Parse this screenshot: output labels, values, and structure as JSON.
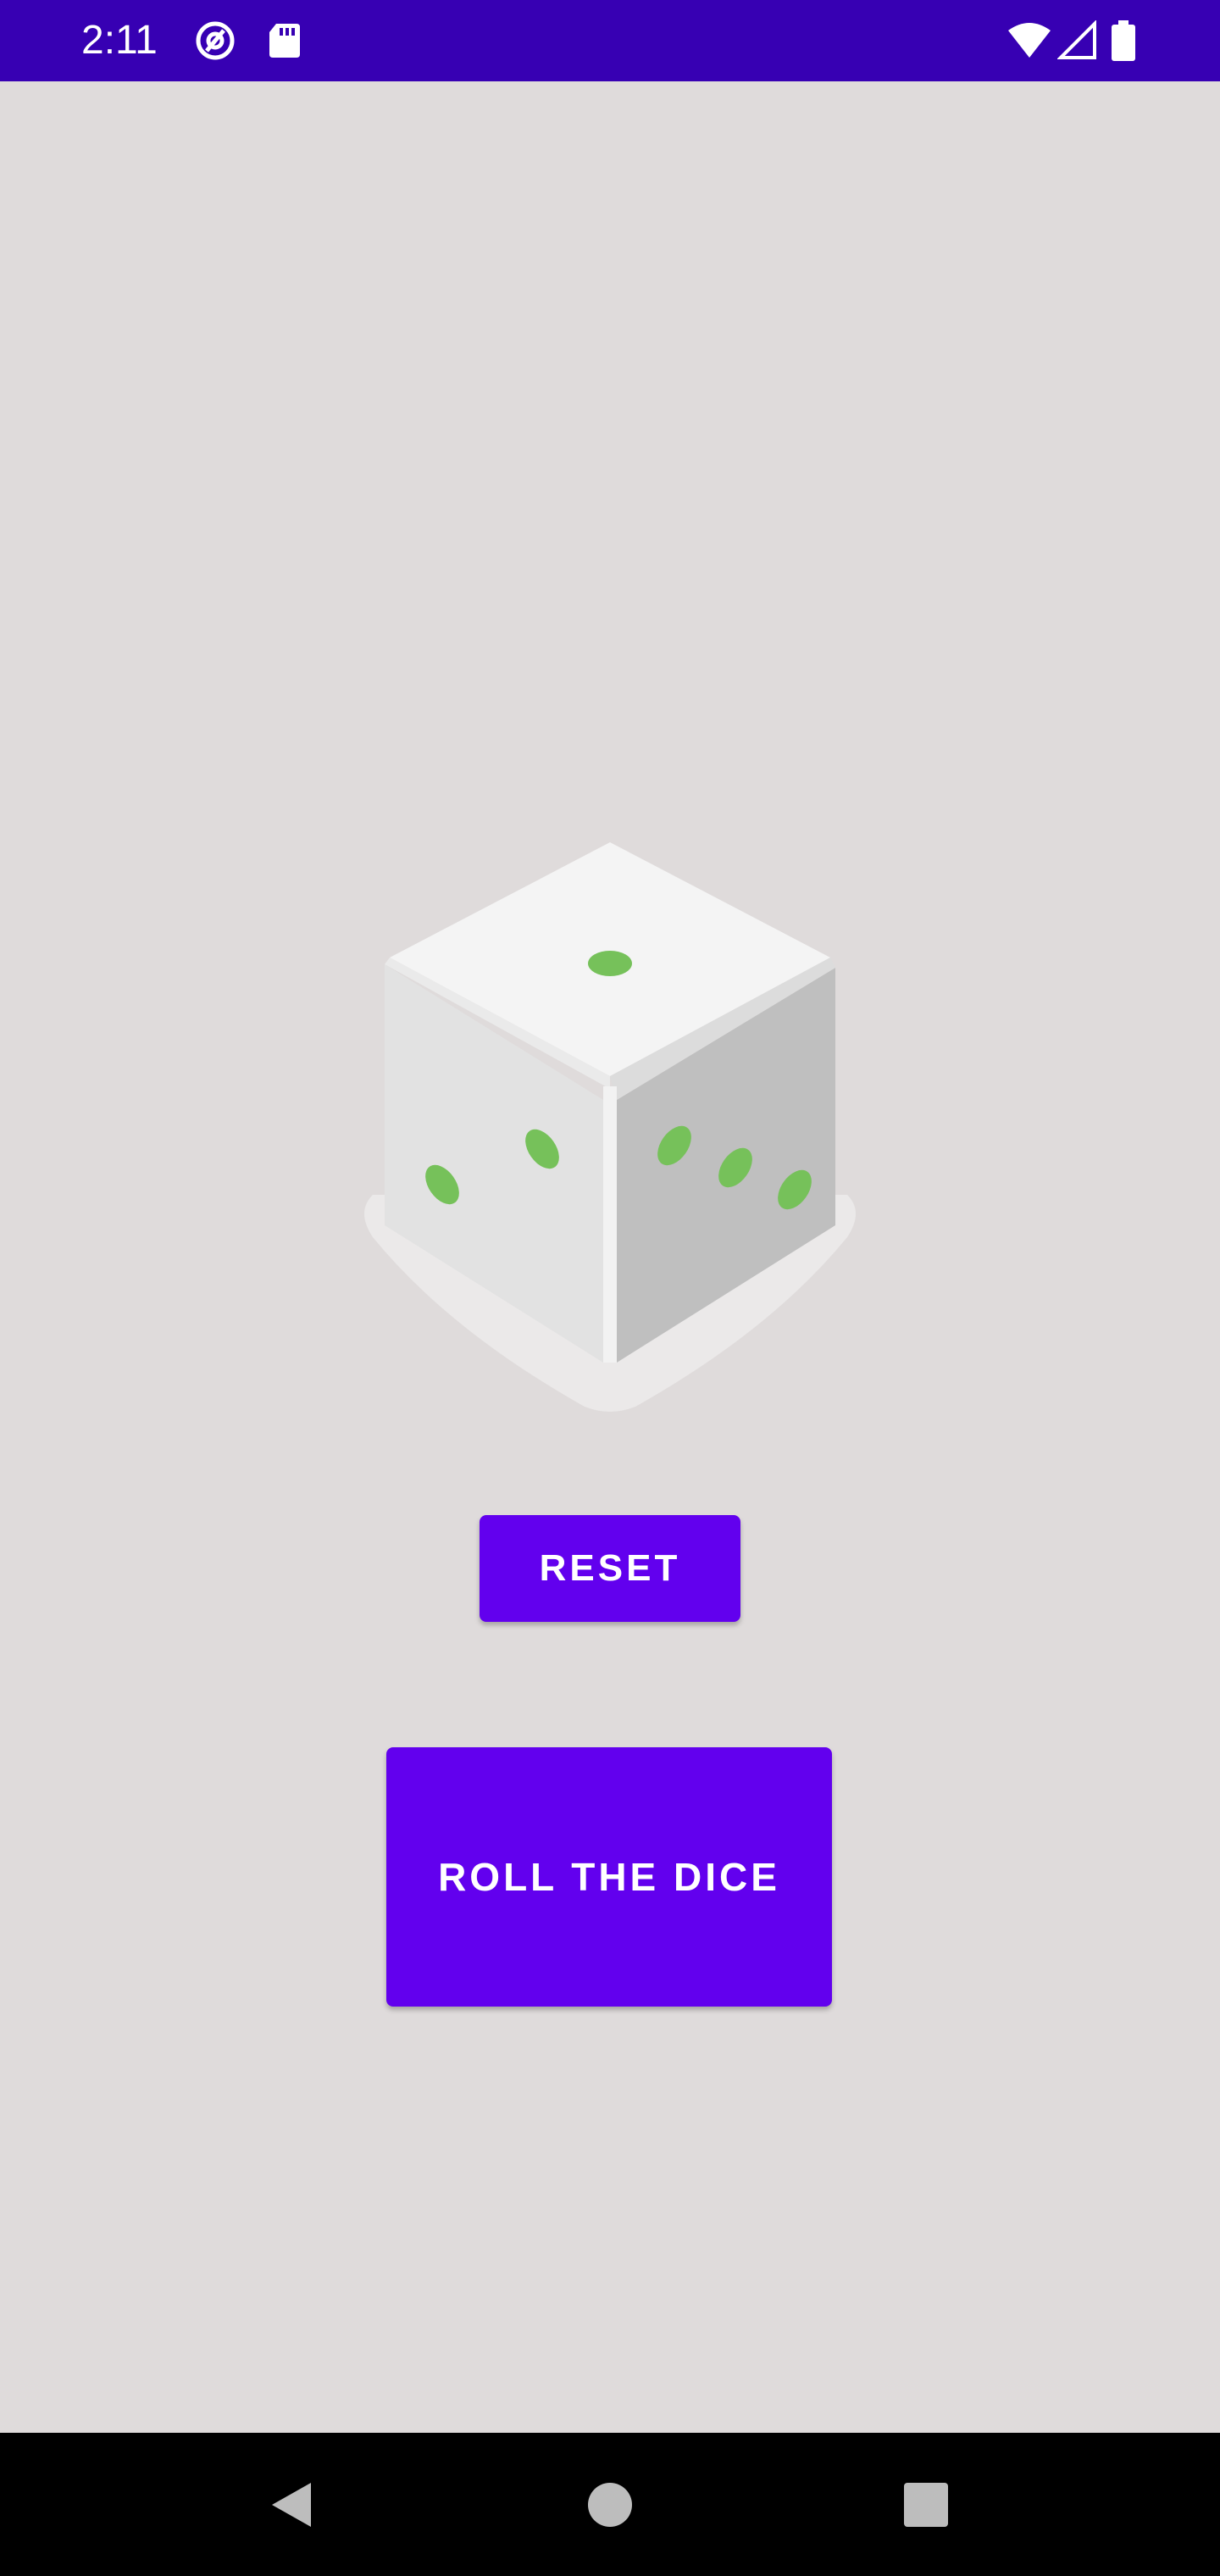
{
  "status_bar": {
    "time": "2:11",
    "bg_color": "#3700b3",
    "left_icons": [
      "at-sign-icon",
      "sd-card-icon"
    ],
    "right_icons": [
      "wifi-icon",
      "cellular-signal-icon",
      "battery-icon"
    ]
  },
  "main": {
    "dice": {
      "icon": "dice-icon",
      "top_face_pips": 1,
      "left_face_pips": 2,
      "right_face_pips": 3,
      "pip_color": "#76c15a"
    },
    "reset_button": {
      "label": "Reset"
    },
    "roll_button": {
      "label": "Roll the dice"
    },
    "accent_color": "#6200ee"
  },
  "nav_bar": {
    "items": [
      "back-icon",
      "home-icon",
      "recents-icon"
    ]
  }
}
